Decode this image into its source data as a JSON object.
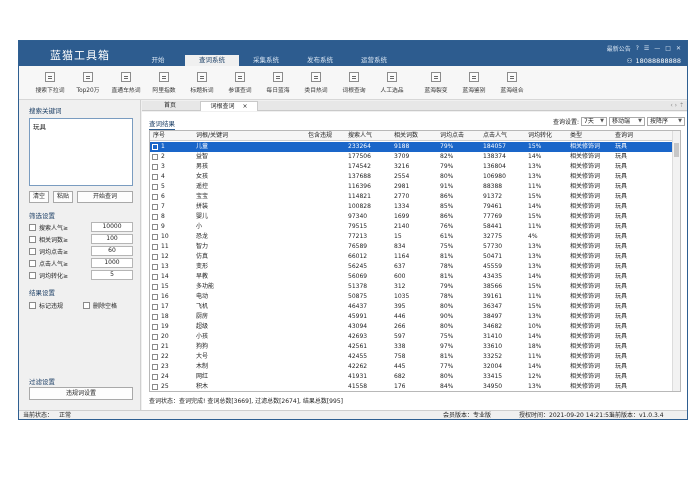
{
  "app": {
    "title": "蓝猫工具箱",
    "menu": [
      "开始",
      "查词系统",
      "采集系统",
      "发布系统",
      "运营系统"
    ],
    "active_menu": "查词系统",
    "top_links": [
      "最新公告",
      "?",
      "☰",
      "—",
      "□",
      "✕"
    ],
    "phone": "18088888888"
  },
  "toolbar": [
    {
      "label": "搜索下拉词",
      "icon": "search-dropdown-icon"
    },
    {
      "label": "Top20万",
      "icon": "top-icon"
    },
    {
      "label": "直通车热词",
      "icon": "car-icon"
    },
    {
      "label": "阿里指数",
      "icon": "index-icon"
    },
    {
      "label": "标题拆词",
      "icon": "split-icon"
    },
    {
      "label": "参谋查词",
      "icon": "advisor-icon"
    },
    {
      "label": "每日蓝海",
      "icon": "daily-icon"
    },
    {
      "label": "类目热词",
      "icon": "category-icon"
    },
    {
      "label": "词根查询",
      "icon": "root-icon"
    },
    {
      "label": "人工选品",
      "icon": "manual-icon"
    },
    {
      "label": "蓝海裂变",
      "icon": "fission-icon"
    },
    {
      "label": "蓝海鉴别",
      "icon": "identify-icon"
    },
    {
      "label": "蓝海组合",
      "icon": "combine-icon"
    }
  ],
  "left": {
    "keyword_section": "搜索关键词",
    "keyword_value": "玩具",
    "buttons": {
      "clear": "清空",
      "paste": "粘贴",
      "start": "开始查词"
    },
    "filter_section": "筛选设置",
    "filters": [
      {
        "label": "搜索人气≥",
        "value": "10000"
      },
      {
        "label": "相关词数≥",
        "value": "100"
      },
      {
        "label": "词均点击≥",
        "value": "60"
      },
      {
        "label": "点击人气≥",
        "value": "1000"
      },
      {
        "label": "词均转化≥",
        "value": "5"
      }
    ],
    "result_section": "结果设置",
    "result_opts": [
      "标记违规",
      "删除空格"
    ],
    "filter_settings_section": "过滤设置",
    "filter_button": "违规词设置"
  },
  "tabs": {
    "home": "首页",
    "query": "词根查词",
    "close": "×",
    "nav": "‹  ›  ⇡"
  },
  "results": {
    "label": "查词结果",
    "query_setting_label": "查询设置:",
    "period": "7天",
    "device": "移动端",
    "sort": "按降序",
    "columns": [
      "序号",
      "词根/关键词",
      "包含违规",
      "搜索人气",
      "相关词数",
      "词均点击",
      "点击人气",
      "词均转化",
      "类型",
      "查询词"
    ],
    "rows": [
      [
        "1",
        "儿童",
        "",
        "233264",
        "9188",
        "79%",
        "184057",
        "15%",
        "相关修饰词",
        "玩具"
      ],
      [
        "2",
        "益智",
        "",
        "177506",
        "3709",
        "82%",
        "138374",
        "14%",
        "相关修饰词",
        "玩具"
      ],
      [
        "3",
        "男孩",
        "",
        "174542",
        "3216",
        "79%",
        "136804",
        "13%",
        "相关修饰词",
        "玩具"
      ],
      [
        "4",
        "女孩",
        "",
        "137688",
        "2554",
        "80%",
        "106980",
        "13%",
        "相关修饰词",
        "玩具"
      ],
      [
        "5",
        "遥控",
        "",
        "116396",
        "2981",
        "91%",
        "88388",
        "11%",
        "相关修饰词",
        "玩具"
      ],
      [
        "6",
        "宝宝",
        "",
        "114821",
        "2770",
        "86%",
        "91372",
        "15%",
        "相关修饰词",
        "玩具"
      ],
      [
        "7",
        "拼装",
        "",
        "100828",
        "1334",
        "85%",
        "79461",
        "14%",
        "相关修饰词",
        "玩具"
      ],
      [
        "8",
        "婴儿",
        "",
        "97340",
        "1699",
        "86%",
        "77769",
        "15%",
        "相关修饰词",
        "玩具"
      ],
      [
        "9",
        "小",
        "",
        "79515",
        "2140",
        "76%",
        "58441",
        "11%",
        "相关修饰词",
        "玩具"
      ],
      [
        "10",
        "恐龙",
        "",
        "77213",
        "15",
        "61%",
        "32775",
        "4%",
        "相关修饰词",
        "玩具"
      ],
      [
        "11",
        "智力",
        "",
        "76589",
        "834",
        "75%",
        "57730",
        "13%",
        "相关修饰词",
        "玩具"
      ],
      [
        "12",
        "仿真",
        "",
        "66012",
        "1164",
        "81%",
        "50471",
        "13%",
        "相关修饰词",
        "玩具"
      ],
      [
        "13",
        "变形",
        "",
        "56245",
        "637",
        "78%",
        "45559",
        "13%",
        "相关修饰词",
        "玩具"
      ],
      [
        "14",
        "早教",
        "",
        "56069",
        "600",
        "81%",
        "43435",
        "14%",
        "相关修饰词",
        "玩具"
      ],
      [
        "15",
        "多功能",
        "",
        "51378",
        "312",
        "79%",
        "38566",
        "15%",
        "相关修饰词",
        "玩具"
      ],
      [
        "16",
        "电动",
        "",
        "50875",
        "1035",
        "78%",
        "39161",
        "11%",
        "相关修饰词",
        "玩具"
      ],
      [
        "17",
        "飞机",
        "",
        "46437",
        "395",
        "80%",
        "36347",
        "15%",
        "相关修饰词",
        "玩具"
      ],
      [
        "18",
        "厨房",
        "",
        "45991",
        "446",
        "90%",
        "38497",
        "13%",
        "相关修饰词",
        "玩具"
      ],
      [
        "19",
        "超级",
        "",
        "43094",
        "266",
        "80%",
        "34682",
        "10%",
        "相关修饰词",
        "玩具"
      ],
      [
        "20",
        "小孩",
        "",
        "42693",
        "597",
        "75%",
        "31410",
        "14%",
        "相关修饰词",
        "玩具"
      ],
      [
        "21",
        "狗狗",
        "",
        "42561",
        "338",
        "97%",
        "33610",
        "18%",
        "相关修饰词",
        "玩具"
      ],
      [
        "22",
        "大号",
        "",
        "42455",
        "758",
        "81%",
        "33252",
        "11%",
        "相关修饰词",
        "玩具"
      ],
      [
        "23",
        "木制",
        "",
        "42262",
        "445",
        "77%",
        "32004",
        "14%",
        "相关修饰词",
        "玩具"
      ],
      [
        "24",
        "网红",
        "",
        "41931",
        "682",
        "80%",
        "33415",
        "12%",
        "相关修饰词",
        "玩具"
      ],
      [
        "25",
        "积木",
        "",
        "41558",
        "176",
        "84%",
        "34950",
        "13%",
        "相关修饰词",
        "玩具"
      ]
    ],
    "summary": "查词状态：查词完成! 查词总数[3669], 过滤总数[2674], 结果总数[995]"
  },
  "status": {
    "state_label": "当前状态：",
    "state_value": "正常",
    "member": "会员版本：专业版",
    "auth": "授权时间：2021-09-20 14:21:53",
    "version": "当前版本：v1.0.3.4"
  }
}
